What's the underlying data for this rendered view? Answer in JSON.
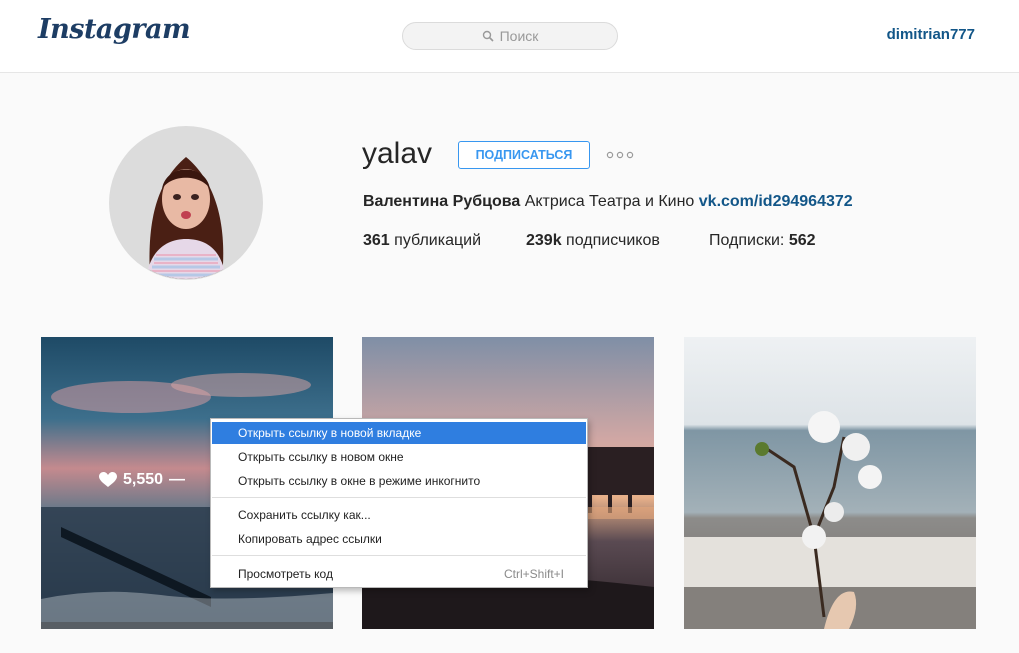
{
  "header": {
    "logo": "Instagram",
    "search_placeholder": "Поиск",
    "current_user": "dimitrian777"
  },
  "profile": {
    "username": "yalav",
    "follow_label": "ПОДПИСАТЬСЯ",
    "full_name": "Валентина Рубцова",
    "bio_text": "Актриса Театра и Кино",
    "bio_link": "vk.com/id294964372",
    "stats": {
      "posts_count": "361",
      "posts_label": "публикаций",
      "followers_count": "239k",
      "followers_label": "подписчиков",
      "following_label": "Подписки:",
      "following_count": "562"
    }
  },
  "posts": [
    {
      "likes": "5,550",
      "dash": "—"
    },
    {},
    {}
  ],
  "context_menu": {
    "items": [
      {
        "label": "Открыть ссылку в новой вкладке",
        "highlighted": true
      },
      {
        "label": "Открыть ссылку в новом окне"
      },
      {
        "label": "Открыть ссылку в окне в режиме инкогнито"
      },
      {
        "label": "Сохранить ссылку как..."
      },
      {
        "label": "Копировать адрес ссылки"
      },
      {
        "label": "Просмотреть код",
        "shortcut": "Ctrl+Shift+I"
      }
    ]
  },
  "colors": {
    "accent": "#3897f0",
    "link": "#125688",
    "menu_highlight": "#2f7ee0"
  }
}
